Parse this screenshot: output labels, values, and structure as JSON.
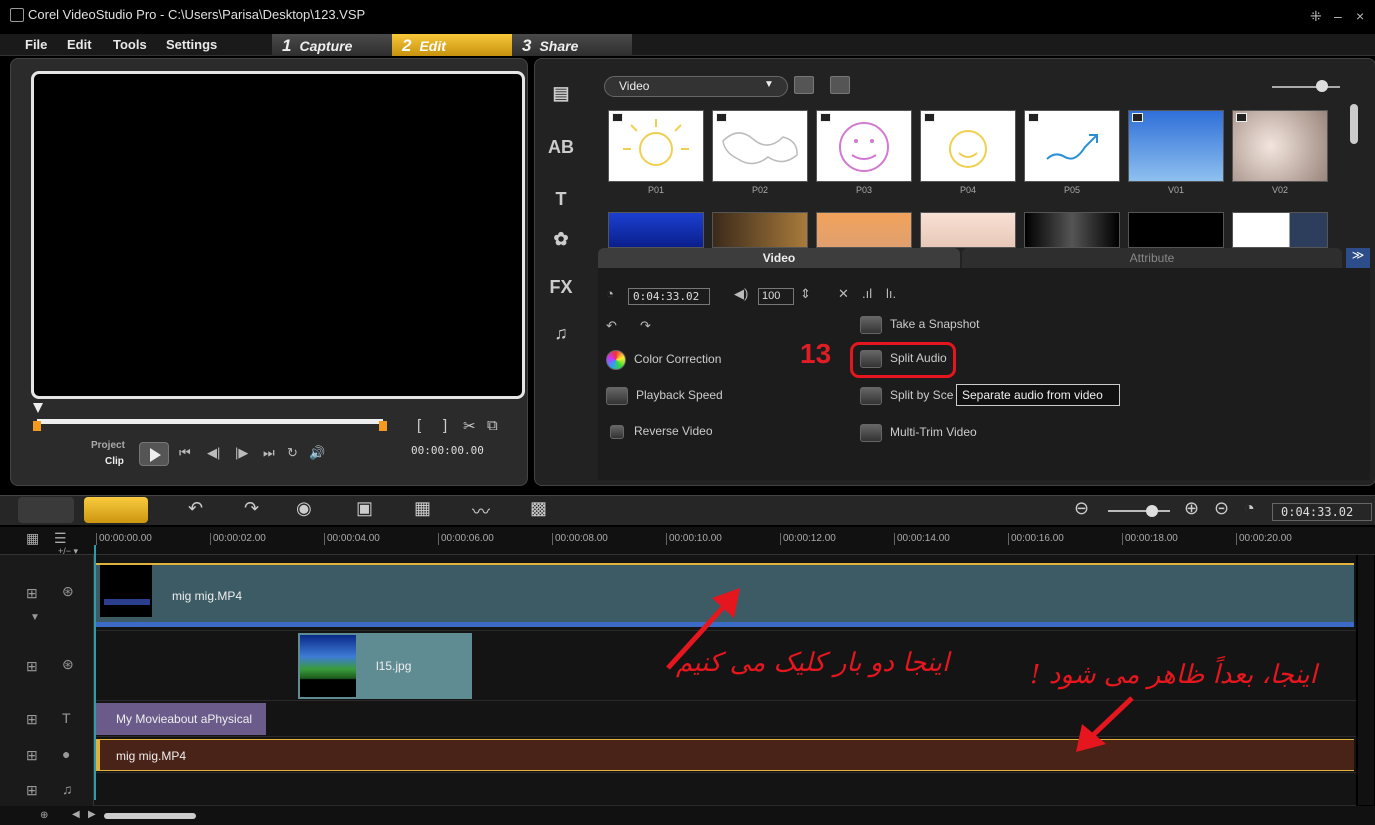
{
  "window": {
    "title": "Corel VideoStudio Pro - C:\\Users\\Parisa\\Desktop\\123.VSP",
    "controls": [
      "⁜",
      "–",
      "×"
    ]
  },
  "menu": {
    "items": [
      "File",
      "Edit",
      "Tools",
      "Settings"
    ],
    "steps": [
      {
        "num": "1",
        "label": "Capture"
      },
      {
        "num": "2",
        "label": "Edit"
      },
      {
        "num": "3",
        "label": "Share"
      }
    ]
  },
  "preview": {
    "mode_project": "Project",
    "mode_clip": "Clip",
    "timecode": "00:00:00.00"
  },
  "library": {
    "category": "Video",
    "thumbnails": [
      {
        "label": "P01"
      },
      {
        "label": "P02"
      },
      {
        "label": "P03"
      },
      {
        "label": "P04"
      },
      {
        "label": "P05"
      },
      {
        "label": "V01"
      },
      {
        "label": "V02"
      }
    ],
    "tabs": {
      "video": "Video",
      "attribute": "Attribute"
    }
  },
  "options": {
    "duration": "0:04:33.02",
    "volume": "100",
    "buttons": {
      "take_snapshot": "Take a Snapshot",
      "color_correction": "Color Correction",
      "split_audio": "Split Audio",
      "playback_speed": "Playback Speed",
      "split_by_scene": "Split by Sce",
      "reverse_video": "Reverse Video",
      "multi_trim": "Multi-Trim Video"
    },
    "tooltip": "Separate audio from video",
    "step_number": "13"
  },
  "timeline": {
    "duration": "0:04:33.02",
    "ruler": [
      "00:00:00.00",
      "00:00:02.00",
      "00:00:04.00",
      "00:00:06.00",
      "00:00:08.00",
      "00:00:10.00",
      "00:00:12.00",
      "00:00:14.00",
      "00:00:16.00",
      "00:00:18.00",
      "00:00:20.00"
    ],
    "ruler_sub": "+/− ▾",
    "clips": {
      "video": "mig mig.MP4",
      "overlay": "l15.jpg",
      "title": "My Movieabout aPhysical",
      "voice": "mig mig.MP4"
    }
  },
  "annotations": {
    "double_click_here": "اینجا دو بار کلیک می کنیم",
    "appears_here_later": "اینجا، بعداً ظاهر می شود !"
  },
  "colors": {
    "accent_yellow": "#f2b21b",
    "annotation_red": "#e5161e"
  }
}
